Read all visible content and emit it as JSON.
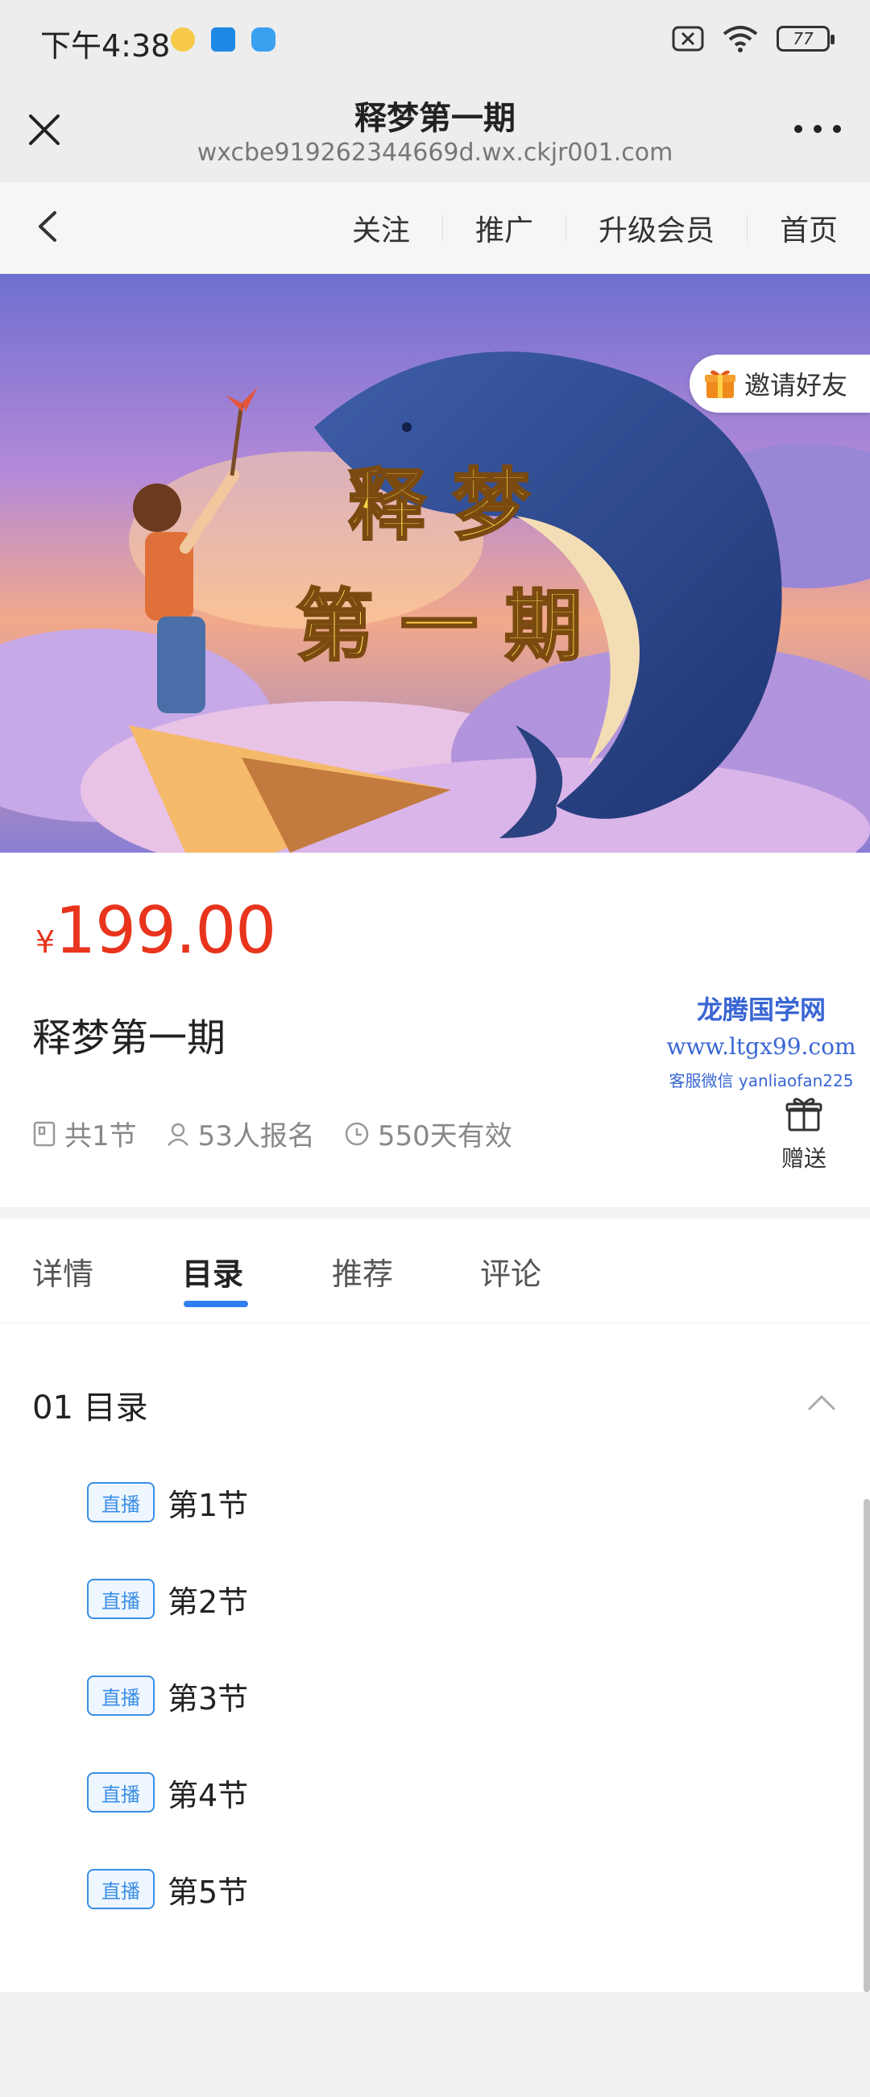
{
  "status_bar": {
    "time": "下午4:38",
    "battery": "77"
  },
  "titlebar": {
    "title": "释梦第一期",
    "url": "wxcbe919262344669d.wx.ckjr001.com"
  },
  "nav": {
    "links": [
      "关注",
      "推广",
      "升级会员",
      "首页"
    ]
  },
  "banner": {
    "art_line1": "释 梦",
    "art_line2": "第 一 期",
    "invite_label": "邀请好友"
  },
  "course": {
    "currency": "¥",
    "price": "199.00",
    "title": "释梦第一期",
    "lessons_count": "共1节",
    "enrolled": "53人报名",
    "validity": "550天有效",
    "gift_label": "赠送"
  },
  "watermark": {
    "line1": "龙腾国学网",
    "line2": "www.ltgx99.com",
    "line3": "客服微信 yanliaofan225"
  },
  "tabs": [
    "详情",
    "目录",
    "推荐",
    "评论"
  ],
  "catalog": {
    "heading": "01 目录",
    "badge": "直播",
    "lessons": [
      "第1节",
      "第2节",
      "第3节",
      "第4节",
      "第5节"
    ]
  },
  "colors": {
    "price": "#e8341c",
    "accent": "#2f7ff0",
    "badge": "#3a8ee6"
  }
}
